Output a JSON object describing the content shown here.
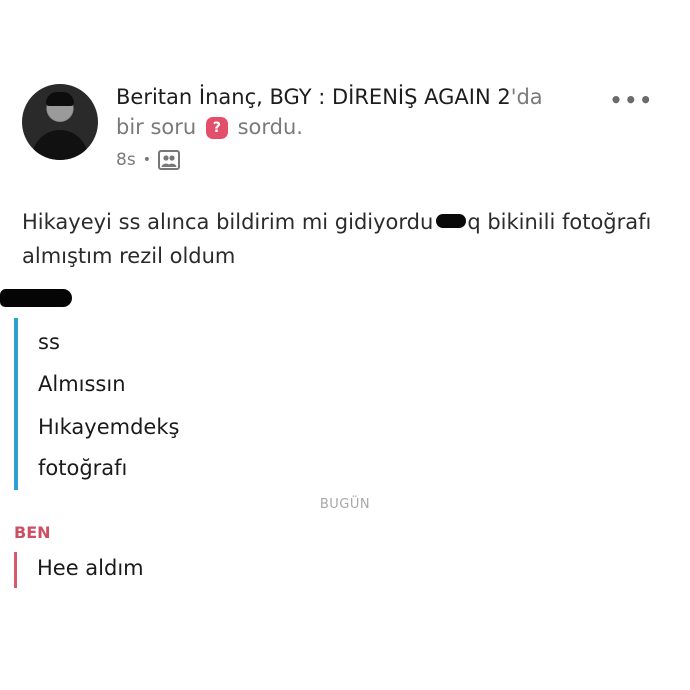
{
  "post": {
    "author": "Beritan İnanç, BGY : DİRENİŞ AGAIN 2",
    "author_suffix": "'da",
    "action_prefix": "bir soru",
    "action_badge": "?",
    "action_suffix": "sordu.",
    "time": "8s",
    "privacy_icon": "group-icon",
    "more_icon": "•••",
    "text_before": "Hikayeyi ss alınca bildirim mi gidiyordu",
    "text_after": "q bikinili fotoğrafı almıştım rezil oldum"
  },
  "chat": {
    "quoted_messages": [
      "ss",
      "Almıssın",
      "Hıkayemdekş",
      "fotoğrafı"
    ],
    "date_label": "BUGÜN",
    "me_label": "BEN",
    "reply": "Hee aldım"
  },
  "colors": {
    "quote_bar": "#2d9fd0",
    "reply_bar": "#d65a6c",
    "question_badge": "#e34f6a"
  }
}
